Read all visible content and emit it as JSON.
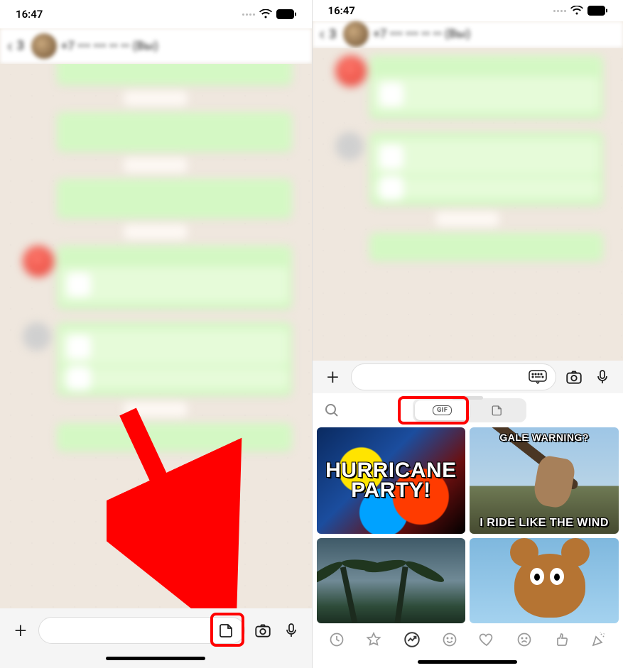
{
  "status": {
    "time": "16:47"
  },
  "header": {
    "back_count": "3",
    "contact": "+7 ••• ••• •• •• (Вы)"
  },
  "inputbar": {
    "placeholder": ""
  },
  "gif": {
    "tab_gif_label": "GIF",
    "tiles": {
      "t1": "HURRICANE PARTY!",
      "t2_top": "GALE WARNING?",
      "t2_bottom": "I RIDE LIKE THE WIND"
    },
    "categories": [
      "recent",
      "favorite",
      "trending",
      "smile",
      "heart",
      "sad",
      "thumbsup",
      "party"
    ]
  }
}
